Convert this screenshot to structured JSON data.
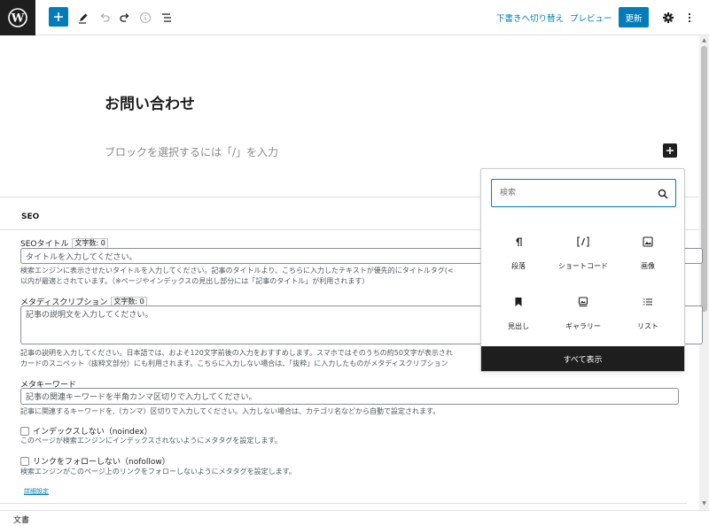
{
  "toolbar": {
    "switch_to_draft": "下書きへ切り替え",
    "preview": "プレビュー",
    "update": "更新"
  },
  "editor": {
    "post_title": "お問い合わせ",
    "block_placeholder": "ブロックを選択するには「/」を入力"
  },
  "seo": {
    "section_title": "SEO",
    "title_label": "SEOタイトル",
    "title_count": "文字数: 0",
    "title_placeholder": "タイトルを入力してください。",
    "title_help_1": "検索エンジンに表示させたいタイトルを入力してください。記事のタイトルより、こちらに入力したテキストが優先的にタイトルタグ(<",
    "title_help_2": "以内が最適とされています。（※ページやインデックスの見出し部分には「記事のタイトル」が利用されます）",
    "desc_label": "メタディスクリプション",
    "desc_count": "文字数: 0",
    "desc_placeholder": "記事の説明文を入力してください。",
    "desc_help_1": "記事の説明を入力してください。日本語では、およそ120文字前後の入力をおすすめします。スマホではそのうちの約50文字が表示され",
    "desc_help_2": "カードのスニペット（抜粋文部分）にも利用されます。こちらに入力しない場合は、「抜粋」に入力したものがメタディスクリプション",
    "keyword_label": "メタキーワード",
    "keyword_placeholder": "記事の関連キーワードを半角カンマ区切りで入力してください。",
    "keyword_help": "記事に関連するキーワードを,（カンマ）区切りで入力してください。入力しない場合は、カテゴリ名などから自動で設定されます。",
    "noindex_label": "インデックスしない（noindex）",
    "noindex_help": "このページが検索エンジンにインデックスされないようにメタタグを設定します。",
    "nofollow_label": "リンクをフォローしない（nofollow）",
    "nofollow_help": "検索エンジンがこのページ上のリンクをフォローしないようにメタタグを設定します。",
    "detail_link": "詳細設定"
  },
  "inserter": {
    "search_placeholder": "検索",
    "blocks": [
      {
        "label": "段落",
        "icon": "paragraph-icon"
      },
      {
        "label": "ショートコード",
        "icon": "shortcode-icon"
      },
      {
        "label": "画像",
        "icon": "image-icon"
      },
      {
        "label": "見出し",
        "icon": "heading-bookmark-icon"
      },
      {
        "label": "ギャラリー",
        "icon": "gallery-icon"
      },
      {
        "label": "リスト",
        "icon": "list-icon"
      }
    ],
    "show_all": "すべて表示"
  },
  "footer": {
    "breadcrumb": "文書"
  },
  "colors": {
    "accent": "#007cba",
    "dark": "#1e1e1e"
  }
}
